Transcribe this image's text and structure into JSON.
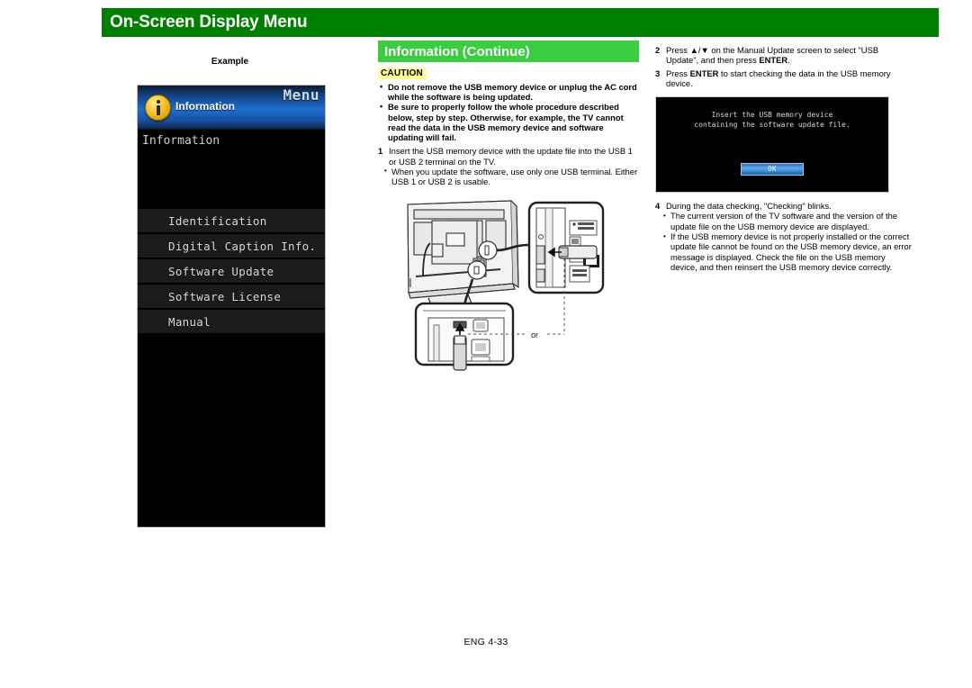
{
  "header": {
    "title": "On-Screen Display Menu"
  },
  "left": {
    "example_label": "Example",
    "tv_menu": {
      "menu_word": "Menu",
      "icon": "info-icon",
      "header_title": "Information",
      "section_label": "Information",
      "rows": [
        "Identification",
        "Digital Caption Info.",
        "Software Update",
        "Software License",
        "Manual"
      ]
    }
  },
  "middle": {
    "subtitle": "Information (Continue)",
    "caution_badge": "CAUTION",
    "caution_bullets": [
      "Do not remove the USB memory device or unplug the AC cord while the software is being updated.",
      "Be sure to properly follow the whole procedure described below, step by step. Otherwise, for example, the TV cannot read the data in the USB memory device and software updating will fail."
    ],
    "step1": {
      "num": "1",
      "text": "Insert the USB memory device with the update file into the USB 1 or USB 2 terminal on the TV."
    },
    "step1_bullets": [
      "When you update the software, use only one USB terminal. Either USB 1 or USB 2 is usable."
    ],
    "diagram": {
      "or_label": "or",
      "caption": "tv-rear-usb-connection-diagram"
    }
  },
  "right": {
    "step2": {
      "num": "2",
      "text_prefix": "Press ",
      "keys": "▲/▼",
      "text_mid": " on the Manual Update screen to select \"USB Update\", and then press ",
      "bold_key": "ENTER",
      "text_suffix": "."
    },
    "step3": {
      "num": "3",
      "text_prefix": "Press ",
      "bold_key": "ENTER",
      "text_suffix": " to start checking the data in the USB memory device."
    },
    "tv_screen": {
      "message_line1": "Insert the USB memory device",
      "message_line2": "containing the software update file.",
      "ok_label": "OK"
    },
    "step4": {
      "num": "4",
      "text": "During the data checking, \"Checking\" blinks."
    },
    "step4_bullets": [
      "The current version of the TV software and the version of the update file on the USB memory device are displayed.",
      "If the USB memory device is not properly installed or the correct update file cannot be found on the USB memory device, an error message is displayed. Check the file on the USB memory device, and then reinsert the USB memory device correctly."
    ]
  },
  "footer": {
    "page_label": "ENG 4-33"
  },
  "colors": {
    "header_green": "#008000",
    "subtitle_green": "#3ccc42",
    "caution_yellow": "#ffff99"
  }
}
